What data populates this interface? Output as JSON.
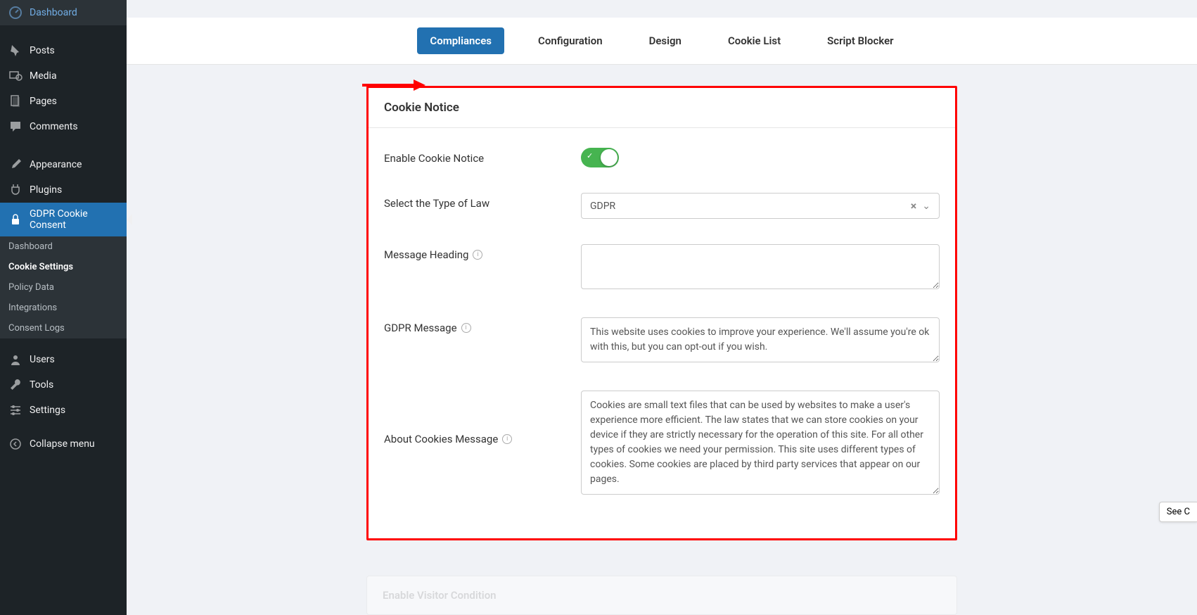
{
  "sidebar": {
    "items": [
      {
        "label": "Dashboard",
        "icon": "dashboard"
      },
      {
        "label": "Posts",
        "icon": "pin"
      },
      {
        "label": "Media",
        "icon": "media"
      },
      {
        "label": "Pages",
        "icon": "pages"
      },
      {
        "label": "Comments",
        "icon": "comment"
      },
      {
        "label": "Appearance",
        "icon": "brush"
      },
      {
        "label": "Plugins",
        "icon": "plug"
      },
      {
        "label": "GDPR Cookie Consent",
        "icon": "lock",
        "active": true
      },
      {
        "label": "Users",
        "icon": "user"
      },
      {
        "label": "Tools",
        "icon": "wrench"
      },
      {
        "label": "Settings",
        "icon": "sliders"
      },
      {
        "label": "Collapse menu",
        "icon": "collapse"
      }
    ],
    "submenu": [
      {
        "label": "Dashboard"
      },
      {
        "label": "Cookie Settings",
        "current": true
      },
      {
        "label": "Policy Data"
      },
      {
        "label": "Integrations"
      },
      {
        "label": "Consent Logs"
      }
    ]
  },
  "tabs": [
    {
      "label": "Compliances",
      "active": true
    },
    {
      "label": "Configuration"
    },
    {
      "label": "Design"
    },
    {
      "label": "Cookie List"
    },
    {
      "label": "Script Blocker"
    }
  ],
  "card": {
    "title": "Cookie Notice",
    "fields": {
      "enable_label": "Enable Cookie Notice",
      "enable_value": true,
      "law_label": "Select the Type of Law",
      "law_value": "GDPR",
      "heading_label": "Message Heading",
      "heading_value": "",
      "gdpr_label": "GDPR Message",
      "gdpr_value": "This website uses cookies to improve your experience. We'll assume you're ok with this, but you can opt-out if you wish.",
      "about_label": "About Cookies Message",
      "about_value": "Cookies are small text files that can be used by websites to make a user's experience more efficient. The law states that we can store cookies on your device if they are strictly necessary for the operation of this site. For all other types of cookies we need your permission. This site uses different types of cookies. Some cookies are placed by third party services that appear on our pages."
    }
  },
  "next_card_title": "Enable Visitor Condition",
  "see_button": "See C"
}
